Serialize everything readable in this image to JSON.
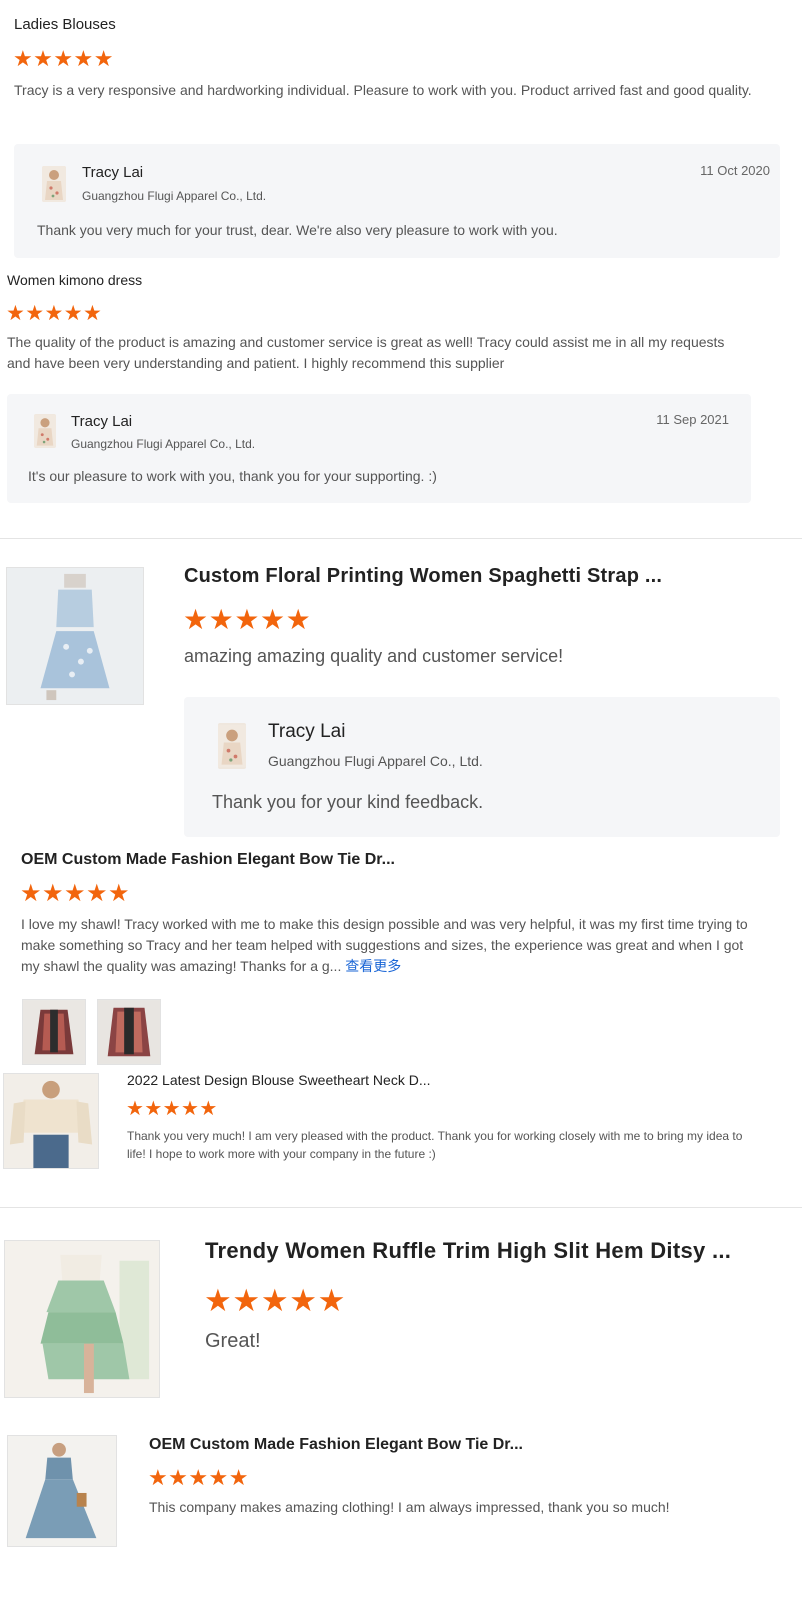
{
  "reviews": [
    {
      "product": "Ladies Blouses",
      "rating": 5,
      "text": "Tracy is a very responsive and hardworking individual. Pleasure to work with you. Product arrived fast and good quality.",
      "reply": {
        "name": "Tracy Lai",
        "company": "Guangzhou Flugi Apparel Co., Ltd.",
        "date": "11 Oct 2020",
        "text": "Thank you very much for your trust, dear. We're also very pleasure to work with you."
      }
    },
    {
      "product": "Women kimono dress",
      "rating": 5,
      "text": "The quality of the product is amazing and customer service is great as well! Tracy could assist me in all my requests and have been very understanding and patient. I highly recommend this supplier",
      "reply": {
        "name": "Tracy Lai",
        "company": "Guangzhou Flugi Apparel Co., Ltd.",
        "date": "11 Sep 2021",
        "text": "It's our pleasure to work with you, thank you for your supporting. :)"
      }
    },
    {
      "product": "Custom Floral Printing Women Spaghetti Strap ...",
      "rating": 5,
      "text": "amazing amazing quality and customer service!",
      "reply": {
        "name": "Tracy Lai",
        "company": "Guangzhou Flugi Apparel Co., Ltd.",
        "text": "Thank you for your kind feedback."
      }
    },
    {
      "product": "OEM Custom Made Fashion Elegant Bow Tie Dr...",
      "rating": 5,
      "text": "I love my shawl! Tracy worked with me to make this design possible and was very helpful, it was my first time trying to make something so Tracy and her team helped with suggestions and sizes, the experience was great and when I got my shawl the quality was amazing! Thanks for a g...",
      "more_label": "查看更多"
    },
    {
      "product": "2022 Latest Design Blouse Sweetheart Neck D...",
      "rating": 5,
      "text": "Thank you very much! I am very pleased with the product. Thank you for working closely with me to bring my idea to life! I hope to work more with your company in the future :)"
    },
    {
      "product": "Trendy Women Ruffle Trim High Slit Hem Ditsy ...",
      "rating": 5,
      "text": "Great!"
    },
    {
      "product": "OEM Custom Made Fashion Elegant Bow Tie Dr...",
      "rating": 5,
      "text": "This company makes amazing clothing! I am always impressed, thank you so much!"
    }
  ],
  "colors": {
    "star": "#f2650d",
    "reply_bg": "#f5f6f8",
    "link": "#1a66d6"
  },
  "icons": {
    "star": "star-icon",
    "avatar": "supplier-avatar",
    "thumb": "product-photo"
  }
}
